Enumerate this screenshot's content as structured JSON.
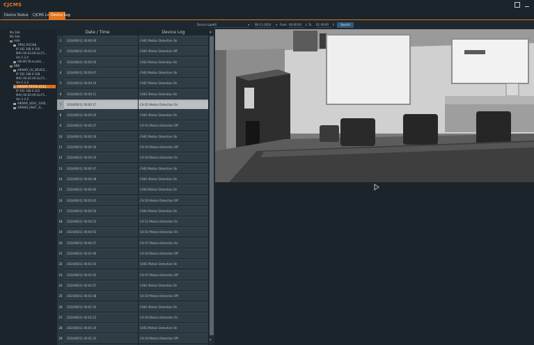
{
  "app": {
    "logo": "CJCMS"
  },
  "tabs": [
    {
      "label": "Device Status",
      "active": false
    },
    {
      "label": "CJCMS Log",
      "active": false
    },
    {
      "label": "Device Log",
      "active": true
    }
  ],
  "filters": {
    "device_type_label": "Device type",
    "device_type_value": "All",
    "from_date": "06-11-2024",
    "from_label": "From",
    "from_time": "00:00:00",
    "to_label": "To",
    "to_time": "01:49:00",
    "search_label": "Search"
  },
  "tree": [
    {
      "label": "My Site",
      "depth": 0,
      "icon": "none"
    },
    {
      "label": "My Site",
      "depth": 0,
      "icon": "none"
    },
    {
      "label": "AAA",
      "depth": 0,
      "icon": "folder"
    },
    {
      "label": "TIPSC-RS7/68",
      "depth": 1,
      "icon": "dvr"
    },
    {
      "label": "IP:192.168.0.100",
      "depth": 2,
      "icon": "none"
    },
    {
      "label": "MAC:90:02:A9:3a:F5...",
      "depth": 2,
      "icon": "none"
    },
    {
      "label": "Ver:1.2.0",
      "depth": 2,
      "icon": "none"
    },
    {
      "label": "AIR-M178-mvlist(...",
      "depth": 1,
      "icon": "dvr"
    },
    {
      "label": "BBB",
      "depth": 0,
      "icon": "folder"
    },
    {
      "label": "AIRNVR_CK_DEVICE...",
      "depth": 1,
      "icon": "dvr"
    },
    {
      "label": "IP:192.168.0.108",
      "depth": 2,
      "icon": "none"
    },
    {
      "label": "MAC:90:02:A9:3a:F5...",
      "depth": 2,
      "icon": "none"
    },
    {
      "label": "Ver:1.2.0",
      "depth": 2,
      "icon": "none"
    },
    {
      "label": "AIRNVR-TRPOS-0242...",
      "depth": 1,
      "icon": "dvr",
      "selected": true
    },
    {
      "label": "IP:192.168.0.102",
      "depth": 2,
      "icon": "none"
    },
    {
      "label": "MAC:90:02:A9:3a:F5...",
      "depth": 2,
      "icon": "none"
    },
    {
      "label": "Ver:1.2.0",
      "depth": 2,
      "icon": "none"
    },
    {
      "label": "AIRNVR_KDS1_3200...",
      "depth": 1,
      "icon": "dvr"
    },
    {
      "label": "AIRNVR_ENVT_3(...",
      "depth": 1,
      "icon": "dvr"
    }
  ],
  "table": {
    "header_date": "Date / Time",
    "header_log": "Device Log",
    "rows": [
      {
        "num": "1",
        "date": "2024/06/11 00:00:00",
        "log": "CH01 Motion Detection On"
      },
      {
        "num": "2",
        "date": "2024/06/11 00:00:02",
        "log": "CH01 Motion Detection Off"
      },
      {
        "num": "3",
        "date": "2024/06/11 00:00:05",
        "log": "CH03 Motion Detection On"
      },
      {
        "num": "4",
        "date": "2024/06/11 00:00:07",
        "log": "CH03 Motion Detection On"
      },
      {
        "num": "5",
        "date": "2024/06/11 00:00:10",
        "log": "CH07 Motion Detection On"
      },
      {
        "num": "6",
        "date": "2024/06/11 00:00:11",
        "log": "CH01 Motion Detection On"
      },
      {
        "num": "7",
        "date": "2024/06/11 00:00:17",
        "log": "CH 01 Motion Detection On",
        "selected": true
      },
      {
        "num": "8",
        "date": "2024/06/11 00:00:20",
        "log": "CH01 Motion Detection On"
      },
      {
        "num": "9",
        "date": "2024/06/11 00:00:27",
        "log": "CH 01 Motion Detection Off"
      },
      {
        "num": "10",
        "date": "2024/06/11 00:00:30",
        "log": "CH01 Motion Detection On"
      },
      {
        "num": "11",
        "date": "2024/06/11 00:00:30",
        "log": "CH 02 Motion Detection Off"
      },
      {
        "num": "12",
        "date": "2024/06/11 00:00:33",
        "log": "CH 02 Motion Detection On"
      },
      {
        "num": "13",
        "date": "2024/06/11 00:00:37",
        "log": "CH03 Motion Detection On"
      },
      {
        "num": "14",
        "date": "2024/06/11 00:00:38",
        "log": "CH01 Motion Detection On"
      },
      {
        "num": "15",
        "date": "2024/06/11 00:00:40",
        "log": "CH03 Motion Detection On"
      },
      {
        "num": "16",
        "date": "2024/06/11 00:00:45",
        "log": "CH 02 Motion Detection Off"
      },
      {
        "num": "17",
        "date": "2024/06/11 00:00:50",
        "log": "CH03 Motion Detection On"
      },
      {
        "num": "18",
        "date": "2024/06/11 00:00:53",
        "log": "CH 11 Motion Detection On"
      },
      {
        "num": "19",
        "date": "2024/06/11 00:00:55",
        "log": "CH 01 Motion Detection On"
      },
      {
        "num": "20",
        "date": "2024/06/11 00:00:57",
        "log": "CH 07 Motion Detection On"
      },
      {
        "num": "21",
        "date": "2024/06/11 00:01:00",
        "log": "CH 02 Motion Detection Off"
      },
      {
        "num": "22",
        "date": "2024/06/11 00:01:03",
        "log": "CH01 Motion Detection On"
      },
      {
        "num": "23",
        "date": "2024/06/11 00:01:05",
        "log": "CH 07 Motion Detection Off"
      },
      {
        "num": "24",
        "date": "2024/06/11 00:01:07",
        "log": "CH01 Motion Detection On"
      },
      {
        "num": "25",
        "date": "2024/06/11 00:01:08",
        "log": "CH 03 Motion Detection Off"
      },
      {
        "num": "26",
        "date": "2024/06/11 00:01:10",
        "log": "CH01 Motion Detection On"
      },
      {
        "num": "27",
        "date": "2024/06/11 00:01:13",
        "log": "CH 02 Motion Detection On"
      },
      {
        "num": "28",
        "date": "2024/06/11 00:01:20",
        "log": "CH03 Motion Detection On"
      },
      {
        "num": "29",
        "date": "2024/06/11 00:01:23",
        "log": "CH 03 Motion Detection Off"
      }
    ]
  },
  "colors": {
    "accent": "#e0761f",
    "background": "#1b242b",
    "row": "#334049",
    "selected_row": "#aab1b5"
  },
  "icons": {
    "restore": "restore-icon",
    "minimize": "minimize-icon",
    "play": "play-icon",
    "dropdown": "chevron-down-icon",
    "spinner": "spinner-icon"
  }
}
